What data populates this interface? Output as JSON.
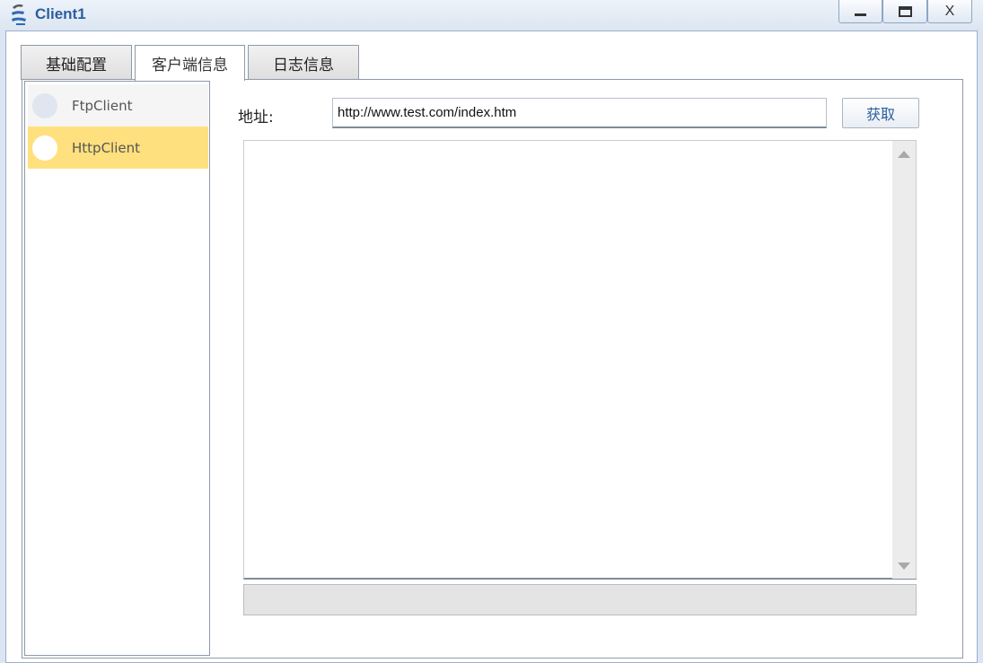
{
  "window": {
    "title": "Client1",
    "icon": "client-app-icon",
    "controls": {
      "minimize_icon": "minimize-icon",
      "maximize_icon": "maximize-icon",
      "close_label": "X"
    }
  },
  "tabs": [
    {
      "label": "基础配置",
      "active": false
    },
    {
      "label": "客户端信息",
      "active": true
    },
    {
      "label": "日志信息",
      "active": false
    }
  ],
  "client_list": {
    "items": [
      {
        "label": "FtpClient",
        "selected": false
      },
      {
        "label": "HttpClient",
        "selected": true
      }
    ]
  },
  "address": {
    "label": "地址:",
    "value": "http://www.test.com/index.htm"
  },
  "fetch_button": {
    "label": "获取"
  },
  "colors": {
    "selected_item": "#ffe07e",
    "title_text": "#2b5f9e",
    "window_frame": "#dce6f2"
  }
}
